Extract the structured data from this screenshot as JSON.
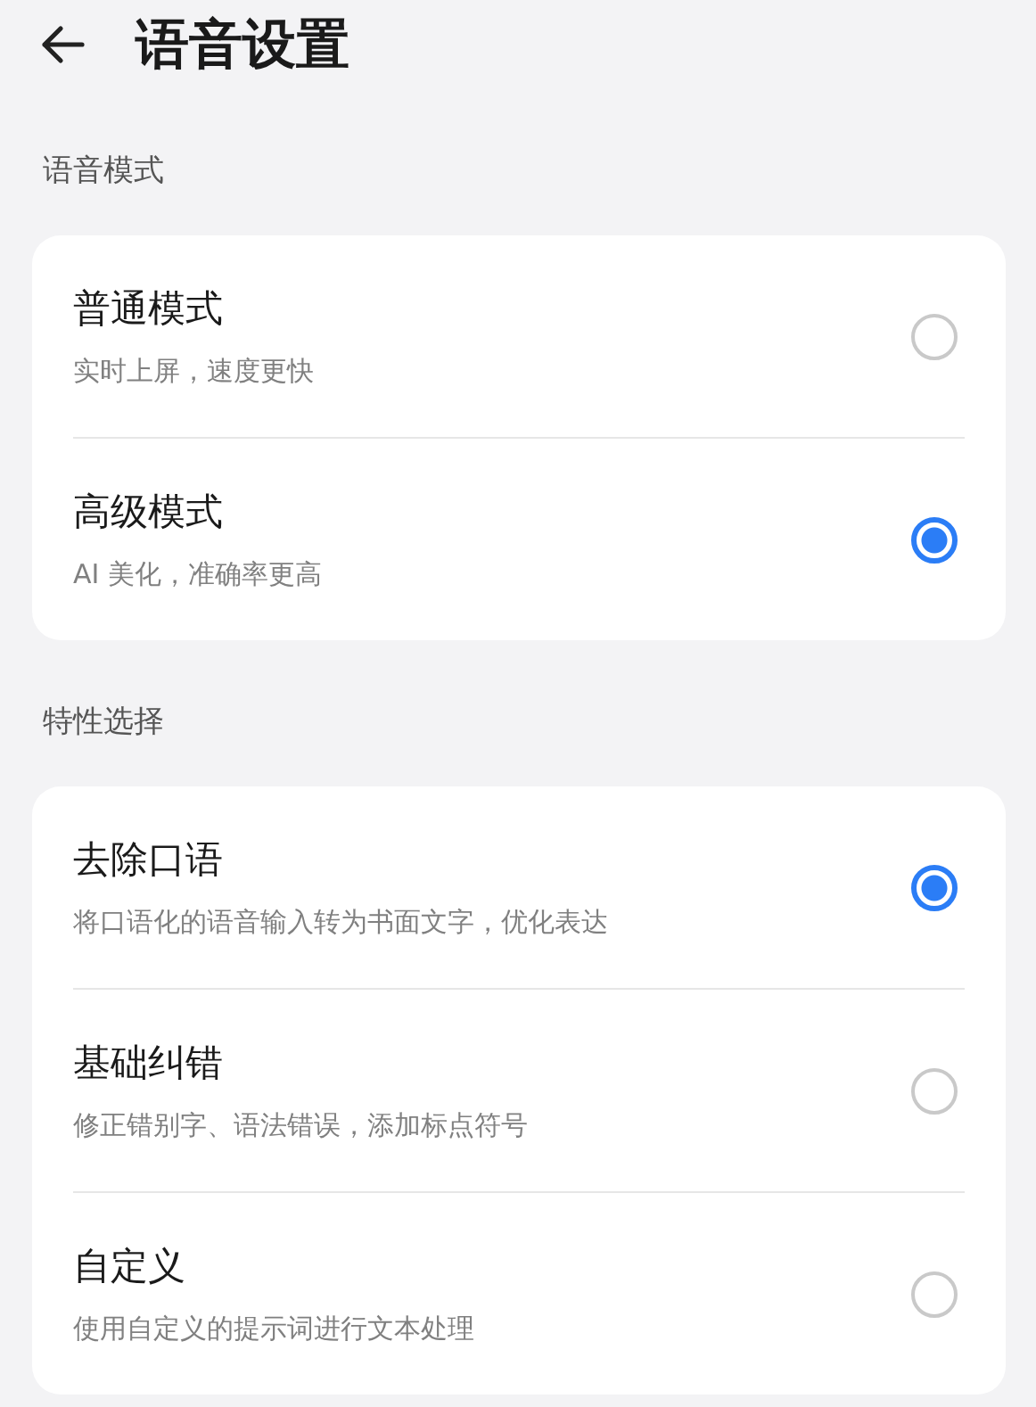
{
  "header": {
    "title": "语音设置"
  },
  "sections": [
    {
      "label": "语音模式",
      "options": [
        {
          "title": "普通模式",
          "subtitle": "实时上屏，速度更快",
          "selected": false
        },
        {
          "title": "高级模式",
          "subtitle": "AI 美化，准确率更高",
          "selected": true
        }
      ]
    },
    {
      "label": "特性选择",
      "options": [
        {
          "title": "去除口语",
          "subtitle": "将口语化的语音输入转为书面文字，优化表达",
          "selected": true
        },
        {
          "title": "基础纠错",
          "subtitle": "修正错别字、语法错误，添加标点符号",
          "selected": false
        },
        {
          "title": "自定义",
          "subtitle": "使用自定义的提示词进行文本处理",
          "selected": false
        }
      ]
    }
  ]
}
